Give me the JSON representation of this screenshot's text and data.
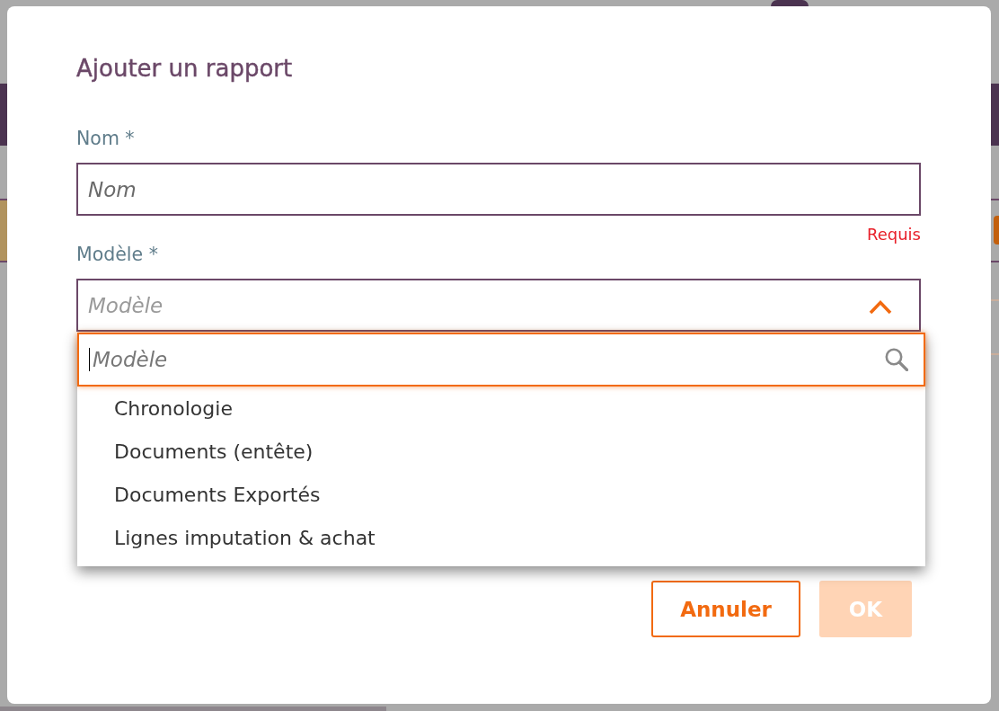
{
  "dialog": {
    "title": "Ajouter un rapport",
    "fields": [
      {
        "kind": "text",
        "label": "Nom *",
        "placeholder": "Nom",
        "error": "Requis"
      },
      {
        "kind": "select",
        "label": "Modèle *",
        "placeholder": "Modèle",
        "expanded": true,
        "dropdown": {
          "search": {
            "placeholder": "Modèle",
            "focused": true
          },
          "options": [
            {
              "label": "Chronologie",
              "selected": false
            },
            {
              "label": "Documents (entête)",
              "selected": false
            },
            {
              "label": "Documents Exportés",
              "selected": false
            },
            {
              "label": "Lignes imputation & achat",
              "selected": false
            }
          ]
        }
      }
    ],
    "buttons": [
      {
        "label": "Annuler",
        "kind": "secondary",
        "disabled": false
      },
      {
        "label": "OK",
        "kind": "primary",
        "disabled": true
      }
    ]
  }
}
